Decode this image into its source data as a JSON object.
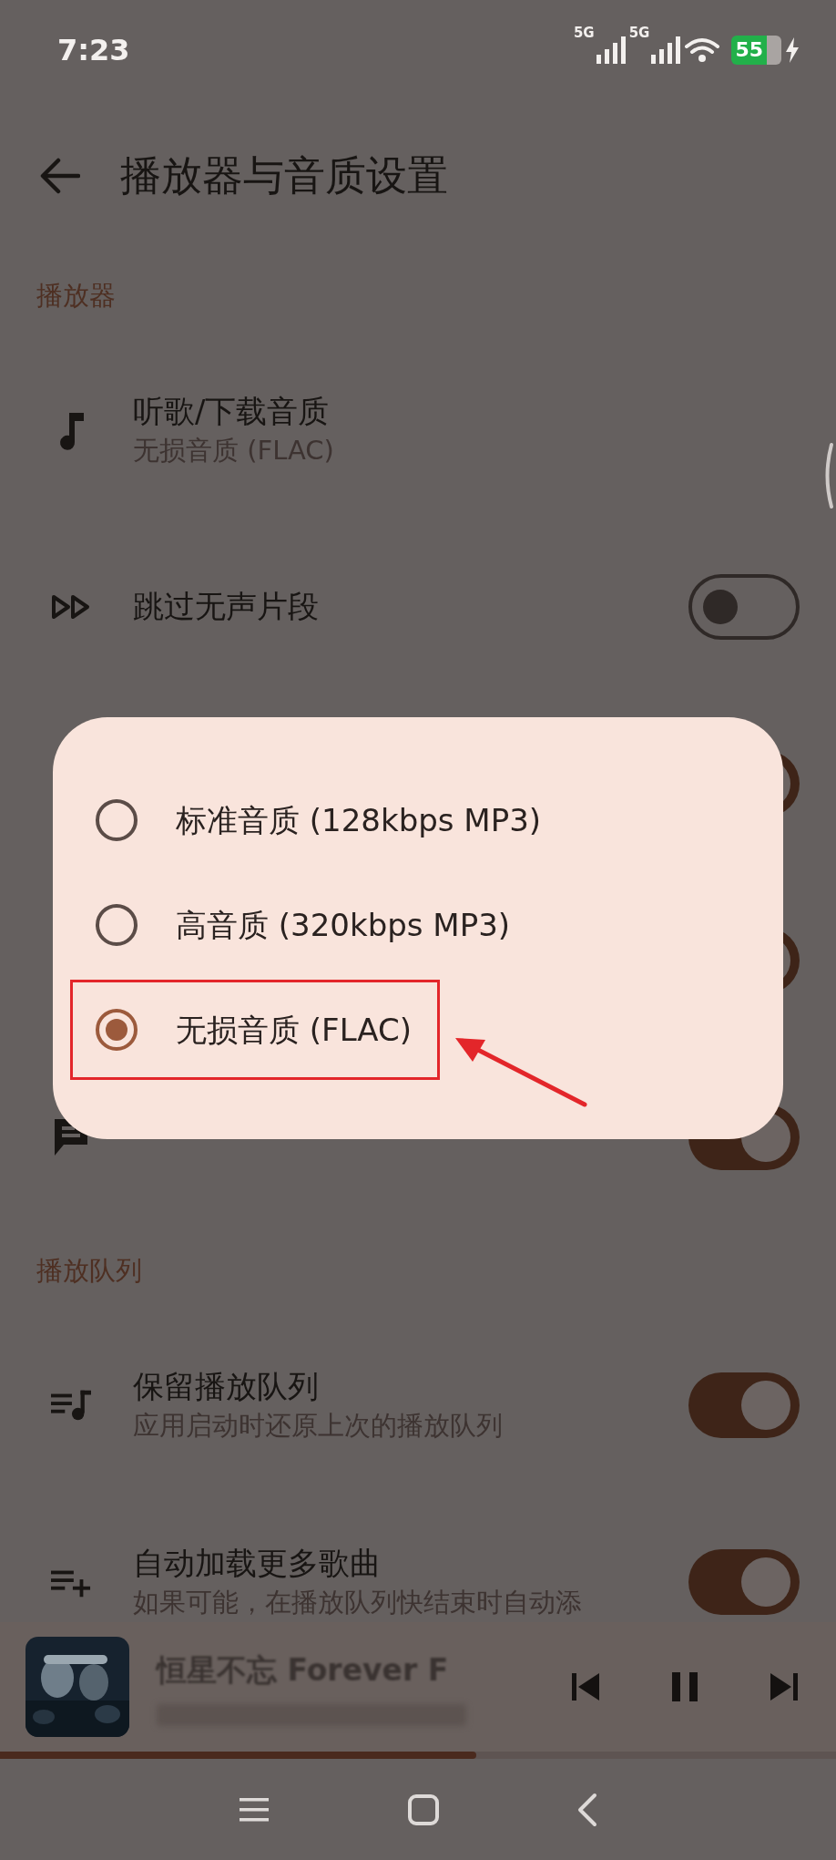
{
  "status_bar": {
    "time": "7:23",
    "networks": [
      "5G",
      "5G"
    ],
    "battery": "55"
  },
  "app_bar": {
    "title": "播放器与音质设置"
  },
  "sections": [
    {
      "header": "播放器",
      "items": [
        {
          "kind": "detail",
          "title": "听歌/下载音质",
          "subtitle": "无损音质 (FLAC)"
        },
        {
          "kind": "switch",
          "title": "跳过无声片段",
          "on": false
        },
        {
          "kind": "switch",
          "on": true
        },
        {
          "kind": "switch",
          "on": true
        },
        {
          "kind": "switch",
          "on": true
        }
      ]
    },
    {
      "header": "播放队列",
      "items": [
        {
          "kind": "switch",
          "title": "保留播放队列",
          "subtitle": "应用启动时还原上次的播放队列",
          "on": true
        },
        {
          "kind": "switch",
          "title": "自动加载更多歌曲",
          "subtitle": "如果可能，在播放队列快结束时自动添",
          "on": true
        }
      ]
    }
  ],
  "dialog": {
    "options": [
      {
        "label": "标准音质 (128kbps MP3)",
        "selected": false,
        "highlighted": false
      },
      {
        "label": "高音质 (320kbps MP3)",
        "selected": false,
        "highlighted": false
      },
      {
        "label": "无损音质 (FLAC)",
        "selected": true,
        "highlighted": true
      }
    ]
  },
  "mini_player": {
    "title": "恒星不忘 Forever F",
    "playing": true,
    "level": 0.57
  }
}
